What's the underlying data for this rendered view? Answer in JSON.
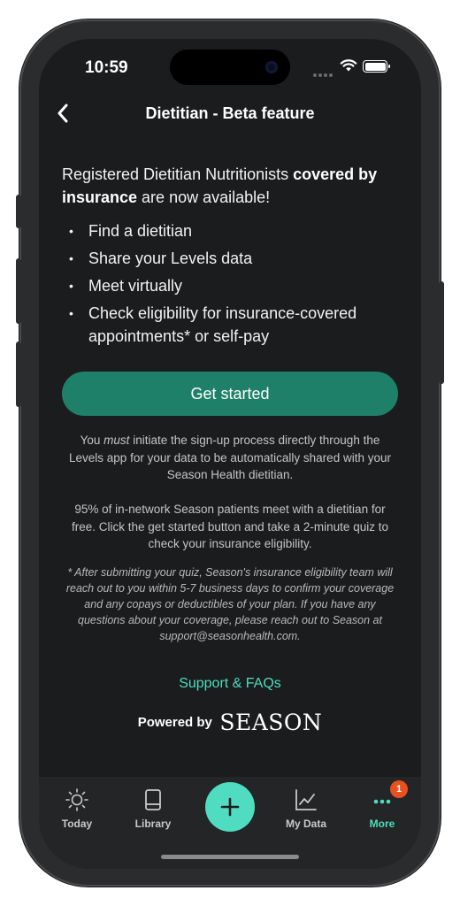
{
  "status_bar": {
    "time": "10:59"
  },
  "header": {
    "title": "Dietitian - Beta feature",
    "back_icon": "chevron-left-icon"
  },
  "intro": {
    "text_before": "Registered Dietitian Nutritionists ",
    "bold": "covered by insurance",
    "text_after": " are now available!"
  },
  "bullets": [
    "Find a dietitian",
    "Share your Levels data",
    "Meet virtually",
    "Check eligibility for insurance-covered appointments* or self-pay"
  ],
  "cta": {
    "label": "Get started",
    "color": "#1f8069"
  },
  "notices": {
    "signup_before": "You ",
    "signup_emphasis": "must",
    "signup_after": " initiate the sign-up process directly through the Levels app for your data to be automatically shared with your Season Health dietitian.",
    "stats": "95% of in-network Season patients meet with a dietitian for free. Click the get started button and take a 2-minute quiz to check your insurance eligibility.",
    "footnote": "* After submitting your quiz, Season's insurance eligibility team will reach out to you within 5-7 business days to confirm your coverage and any copays or deductibles of your plan. If you have any questions about your coverage, please reach out to Season at support@seasonhealth.com."
  },
  "support_link": "Support & FAQs",
  "powered_by": {
    "label": "Powered by",
    "brand": "SEASON"
  },
  "tab_bar": {
    "accent": "#4fdcc0",
    "tabs": [
      {
        "label": "Today",
        "icon": "sun-icon"
      },
      {
        "label": "Library",
        "icon": "book-icon"
      },
      {
        "label": "My Data",
        "icon": "chart-icon"
      },
      {
        "label": "More",
        "icon": "more-icon",
        "badge": "1",
        "active": true
      }
    ],
    "add_icon": "plus-icon"
  }
}
